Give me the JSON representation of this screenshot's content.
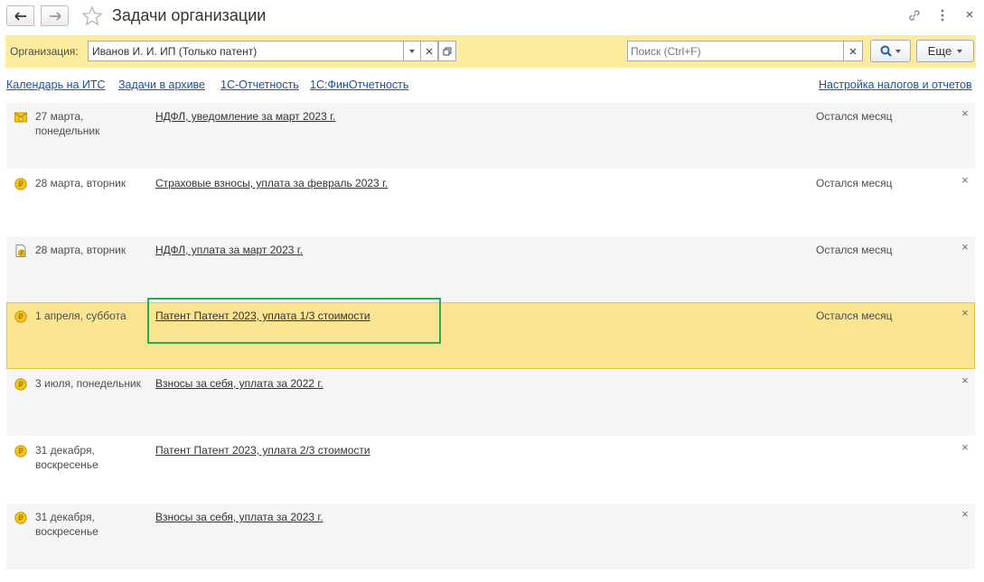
{
  "window": {
    "title": "Задачи организации",
    "close_glyph": "×"
  },
  "filter": {
    "org_label": "Организация:",
    "org_value": "Иванов И. И. ИП (Только патент)",
    "search_placeholder": "Поиск (Ctrl+F)",
    "more_label": "Еще"
  },
  "links": {
    "calendar": "Календарь на ИТС",
    "archive": "Задачи в архиве",
    "reporting": "1С-Отчетность",
    "finreporting": "1С:ФинОтчетность",
    "tax_settings": "Настройка налогов и отчетов"
  },
  "tasks": [
    {
      "icon": "envelope-coin-icon",
      "date": "27 марта, понедельник",
      "title": "НДФЛ, уведомление за март 2023 г.",
      "status": "Остался месяц",
      "close": "×"
    },
    {
      "icon": "coin-icon",
      "date": "28 марта, вторник",
      "title": "Страховые взносы, уплата за февраль 2023 г.",
      "status": "Остался месяц",
      "close": "×"
    },
    {
      "icon": "document-coin-icon",
      "date": "28 марта, вторник",
      "title": "НДФЛ, уплата за март 2023 г.",
      "status": "Остался месяц",
      "close": "×"
    },
    {
      "icon": "coin-icon",
      "date": "1 апреля, суббота",
      "title": "Патент Патент 2023, уплата 1/3 стоимости",
      "status": "Остался месяц",
      "close": "×"
    },
    {
      "icon": "coin-icon",
      "date": "3 июля, понедельник",
      "title": "Взносы за себя, уплата за 2022 г.",
      "status": "",
      "close": "×"
    },
    {
      "icon": "coin-icon",
      "date": "31 декабря, воскресенье",
      "title": "Патент Патент 2023, уплата 2/3 стоимости",
      "status": "",
      "close": "×"
    },
    {
      "icon": "coin-icon",
      "date": "31 декабря, воскресенье",
      "title": "Взносы за себя, уплата за 2023 г.",
      "status": "",
      "close": "×"
    }
  ],
  "colors": {
    "filter_bar": "#fbec9e",
    "selected_row": "#fbe593",
    "link": "#1b52a4",
    "highlight": "#22b14c"
  }
}
